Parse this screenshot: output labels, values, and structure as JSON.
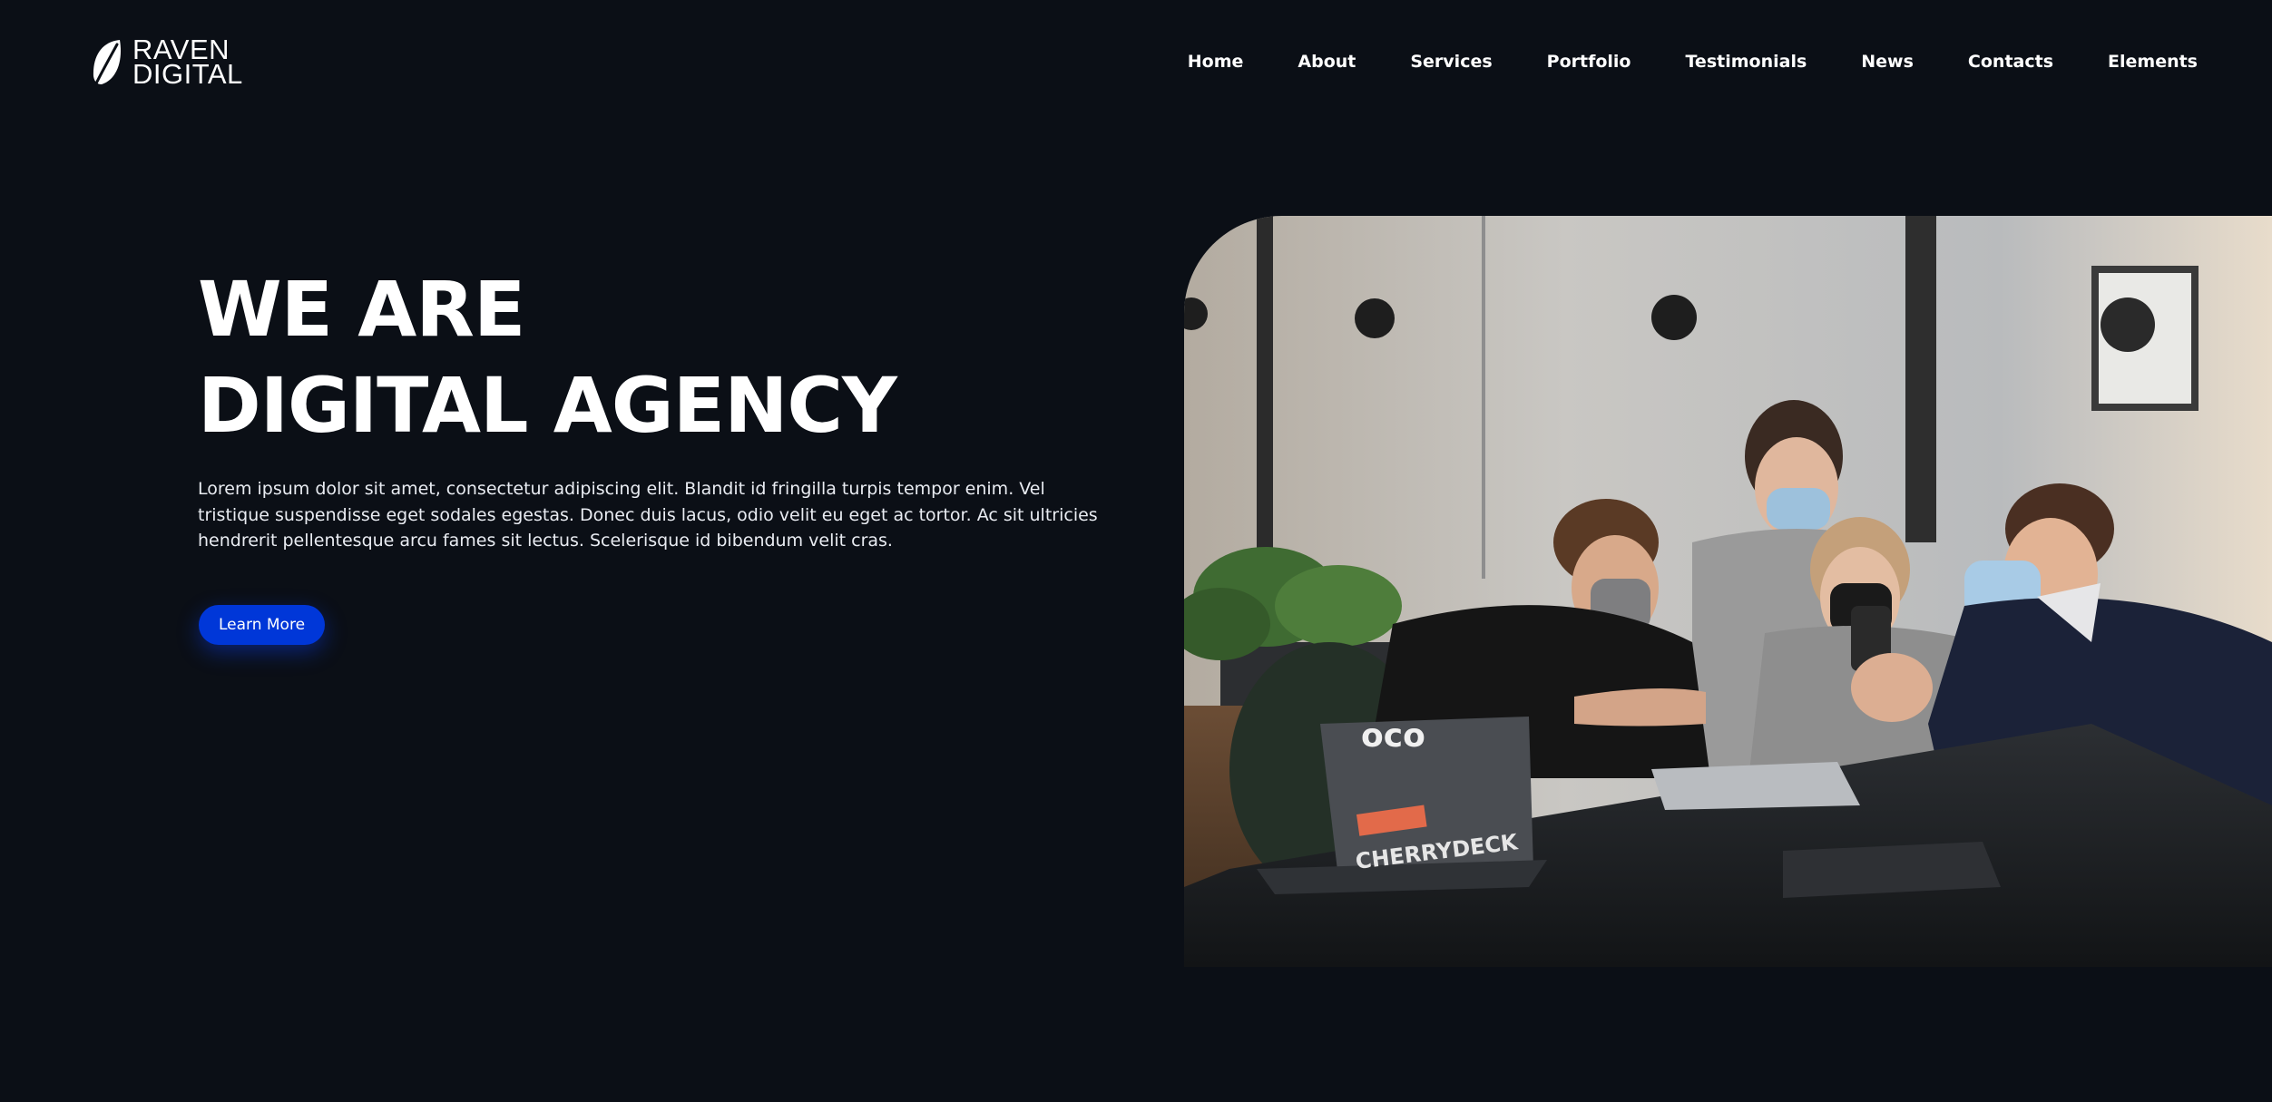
{
  "brand": {
    "name_line1": "RAVEN",
    "name_line2": "DIGITAL",
    "icon": "leaf-icon"
  },
  "nav": {
    "items": [
      {
        "label": "Home"
      },
      {
        "label": "About"
      },
      {
        "label": "Services"
      },
      {
        "label": "Portfolio"
      },
      {
        "label": "Testimonials"
      },
      {
        "label": "News"
      },
      {
        "label": "Contacts"
      },
      {
        "label": "Elements"
      }
    ]
  },
  "hero": {
    "title_line1": "WE ARE",
    "title_line2": "DIGITAL AGENCY",
    "description": "Lorem ipsum dolor sit amet, consectetur adipiscing elit. Blandit id fringilla turpis tempor enim. Vel tristique suspendisse eget sodales egestas. Donec duis lacus, odio velit eu eget ac tortor. Ac sit ultricies hendrerit pellentesque arcu fames sit lectus. Scelerisque id bibendum velit cras.",
    "cta_label": "Learn More",
    "image": {
      "subject": "team-photo",
      "sticker_text": "CHERRYDECK"
    }
  },
  "colors": {
    "background": "#0b0f16",
    "accent": "#0037d8",
    "text": "#ffffff"
  }
}
